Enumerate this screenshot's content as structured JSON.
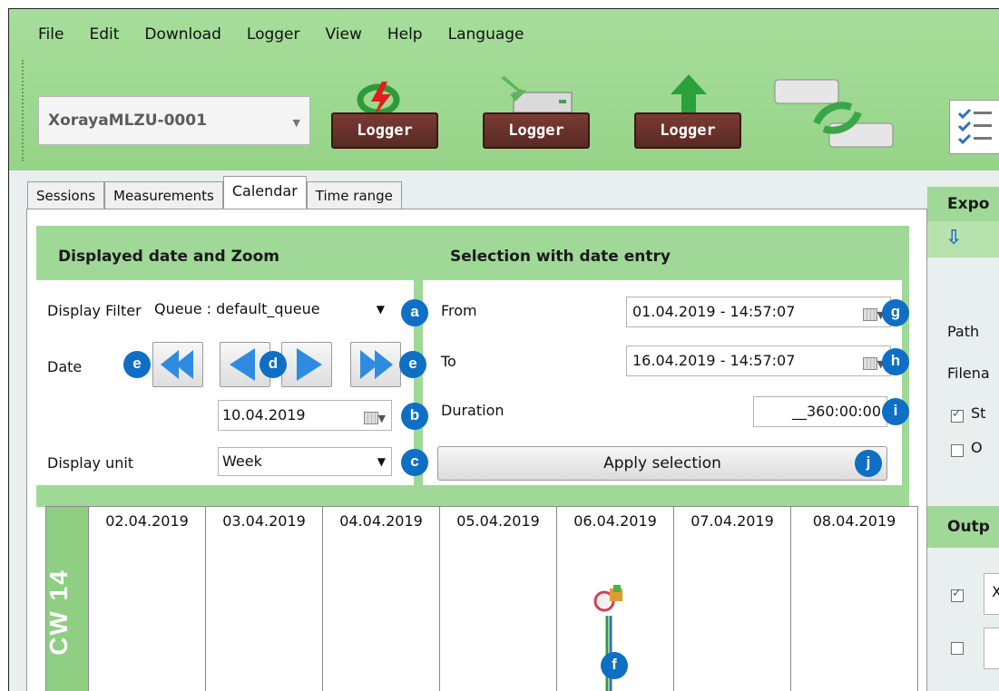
{
  "menu": [
    "File",
    "Edit",
    "Download",
    "Logger",
    "View",
    "Help",
    "Language"
  ],
  "device_combo": {
    "value": "XorayaMLZU-0001"
  },
  "toolbar": {
    "logger1": "Logger",
    "logger2": "Logger",
    "logger3": "Logger"
  },
  "tabs": [
    "Sessions",
    "Measurements",
    "Calendar",
    "Time range"
  ],
  "left_section": {
    "title": "Displayed date and Zoom",
    "display_filter_label": "Display Filter",
    "display_filter_value": "Queue : default_queue",
    "date_label": "Date",
    "date_value": "10.04.2019",
    "display_unit_label": "Display unit",
    "display_unit_value": "Week"
  },
  "right_section": {
    "title": "Selection with date entry",
    "from_label": "From",
    "from_value": "01.04.2019 - 14:57:07",
    "to_label": "To",
    "to_value": "16.04.2019 - 14:57:07",
    "duration_label": "Duration",
    "duration_value": "__360:00:00",
    "apply_label": "Apply selection"
  },
  "badges": {
    "a": "a",
    "b": "b",
    "c": "c",
    "d": "d",
    "e1": "e",
    "e2": "e",
    "f": "f",
    "g": "g",
    "h": "h",
    "i": "i",
    "j": "j"
  },
  "calendar": {
    "week_label": "CW 14",
    "days": [
      "02.04.2019",
      "03.04.2019",
      "04.04.2019",
      "05.04.2019",
      "06.04.2019",
      "07.04.2019",
      "08.04.2019"
    ]
  },
  "right_pane": {
    "export_header": "Expo",
    "path_label": "Path",
    "filename_label": "Filena",
    "check1_label": "St",
    "check2_label": "O",
    "output_header": "Outp",
    "output_field1": "X"
  },
  "colors": {
    "accent_green": "#9fd897",
    "badge_blue": "#0e6fc5",
    "nav_arrow_blue": "#2f8be0"
  }
}
